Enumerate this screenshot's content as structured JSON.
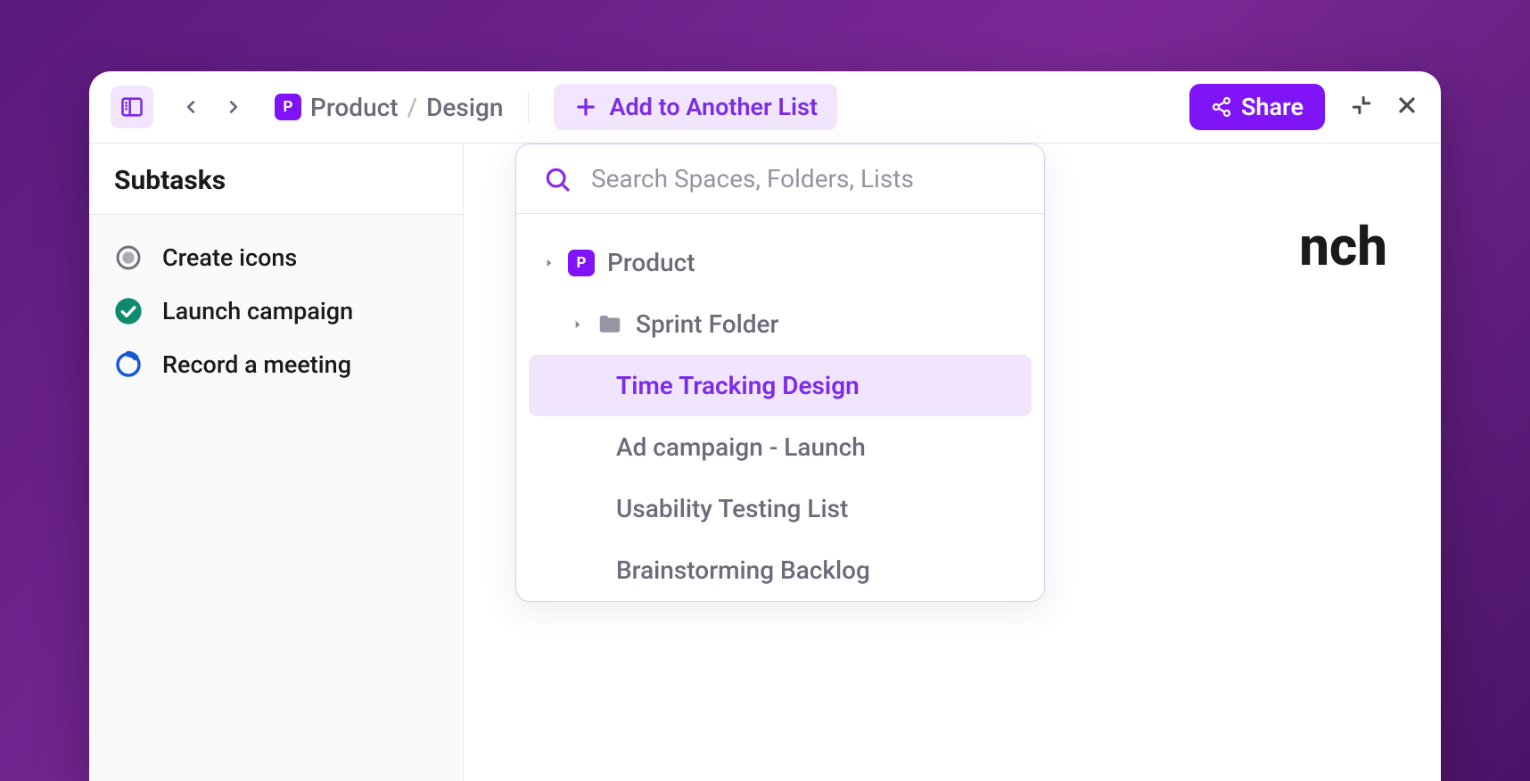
{
  "breadcrumb": {
    "space_badge": "P",
    "items": [
      "Product",
      "Design"
    ]
  },
  "toolbar": {
    "add_to_list_label": "Add to Another List",
    "share_label": "Share"
  },
  "sidebar": {
    "title": "Subtasks",
    "items": [
      {
        "label": "Create icons",
        "status": "open"
      },
      {
        "label": "Launch campaign",
        "status": "complete"
      },
      {
        "label": "Record a meeting",
        "status": "in-progress"
      }
    ]
  },
  "main": {
    "title_fragment": "nch"
  },
  "dropdown": {
    "search_placeholder": "Search Spaces, Folders, Lists",
    "space_badge": "P",
    "space_label": "Product",
    "folder_label": "Sprint Folder",
    "lists": [
      "Time Tracking Design",
      "Ad campaign - Launch",
      "Usability Testing List",
      "Brainstorming Backlog"
    ],
    "selected_index": 0
  }
}
